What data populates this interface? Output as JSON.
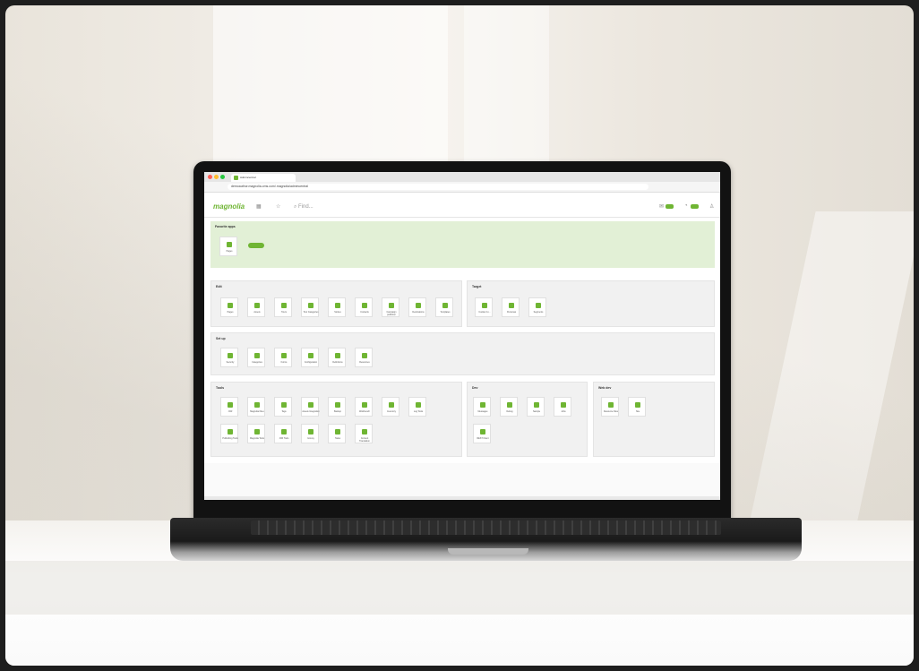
{
  "browser": {
    "tab_title": "Admincentral",
    "url": "demoauthor.magnolia-cms.com/.magnolia/admincentral"
  },
  "app": {
    "logo": "magnolia",
    "search_placeholder": "Find..."
  },
  "favorites": {
    "title": "Favorite apps",
    "items": [
      "Pages"
    ]
  },
  "groups": [
    {
      "title": "Edit",
      "items": [
        "Pages",
        "Assets",
        "Tours",
        "Tour Categories",
        "Stories",
        "Contacts",
        "Campaign publisher",
        "Destinations",
        "Templates"
      ]
    },
    {
      "title": "Target",
      "items": [
        "Cookie Co...",
        "Personas",
        "Segments"
      ]
    },
    {
      "title": "Set up",
      "items": [
        "Security",
        "Categories",
        "Forms",
        "Configuration",
        "Definitions",
        "Resources"
      ]
    },
    {
      "title": "Tools",
      "items": [
        "JCR",
        "Magnolia Files",
        "Tags",
        "Assets Integration",
        "Backup",
        "Workbench",
        "Inventory",
        "Log Tools",
        "Publishing Tools",
        "Magnolia Tools",
        "JCR Tools",
        "Groovy",
        "Tasks",
        "Content Translation"
      ]
    },
    {
      "title": "Dev",
      "items": [
        "Messages",
        "Debug",
        "Sample",
        "Jobs",
        "REST Client"
      ]
    },
    {
      "title": "Web dev",
      "items": [
        "Resource Files",
        "Site"
      ]
    }
  ]
}
